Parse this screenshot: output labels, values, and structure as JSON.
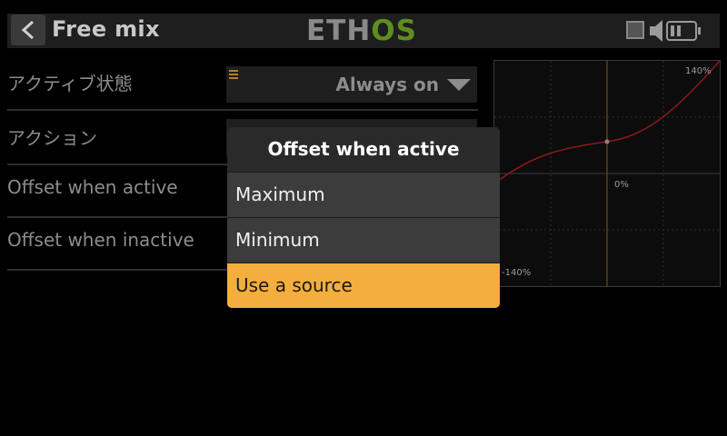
{
  "header": {
    "title": "Free mix",
    "logo_part1": "ETH",
    "logo_part2": "OS"
  },
  "rows": [
    {
      "label": "アクティブ状態"
    },
    {
      "label": "アクション"
    },
    {
      "label": "Offset when active"
    },
    {
      "label": "Offset when inactive"
    }
  ],
  "active_state_select": {
    "value": "Always on"
  },
  "graph": {
    "label_top_right": "140%",
    "label_center": "0%",
    "label_bottom_left": "-140%"
  },
  "popup": {
    "title": "Offset when active",
    "options": [
      "Maximum",
      "Minimum",
      "Use a source"
    ],
    "selected_index": 2
  },
  "colors": {
    "accent": "#f4ae3d",
    "logo_green": "#5e8c20",
    "curve": "#8a1a1a"
  },
  "icons": [
    "back-arrow-icon",
    "record-icon",
    "speaker-icon",
    "battery-icon",
    "chevron-down-icon",
    "edit-icon"
  ]
}
